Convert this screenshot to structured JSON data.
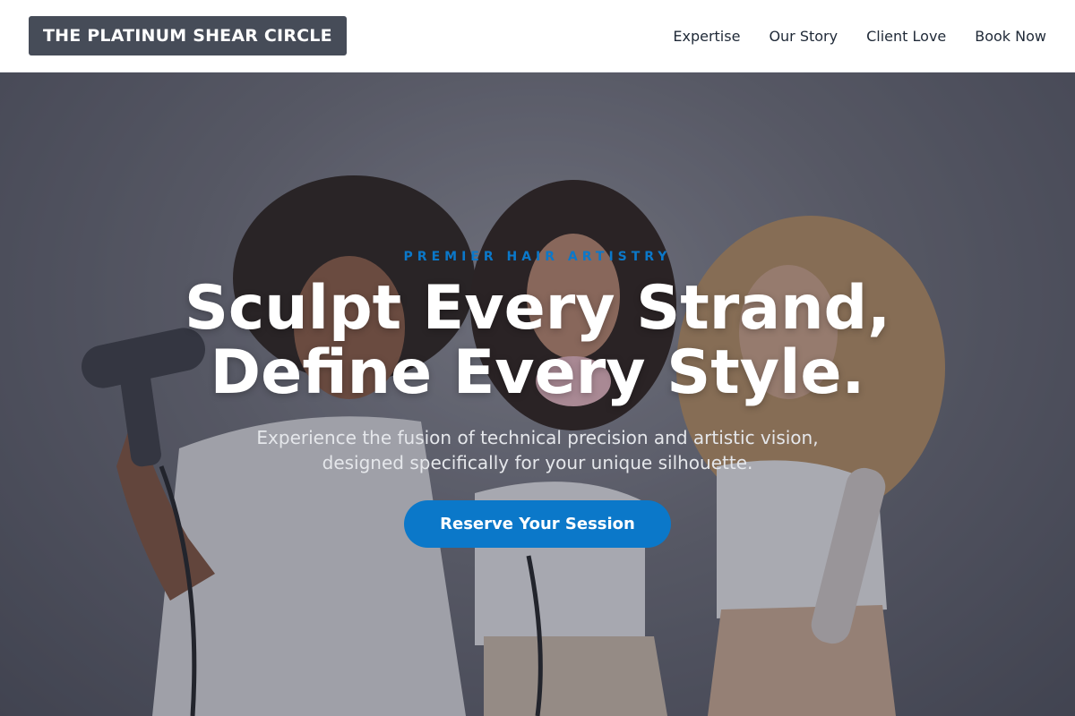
{
  "header": {
    "logo": "THE PLATINUM SHEAR CIRCLE",
    "nav": [
      {
        "label": "Expertise"
      },
      {
        "label": "Our Story"
      },
      {
        "label": "Client Love"
      },
      {
        "label": "Book Now"
      }
    ]
  },
  "hero": {
    "eyebrow": "PREMIER HAIR ARTISTRY",
    "headline_line1": "Sculpt Every Strand,",
    "headline_line2": "Define Every Style.",
    "subtext": "Experience the fusion of technical precision and artistic vision, designed specifically for your unique silhouette.",
    "cta": "Reserve Your Session",
    "image_alt": "Three models styling hair with a hair dryer, a pink dryer and a curling tool"
  },
  "colors": {
    "accent": "#0b78c9",
    "logo_bg": "#464c58"
  }
}
